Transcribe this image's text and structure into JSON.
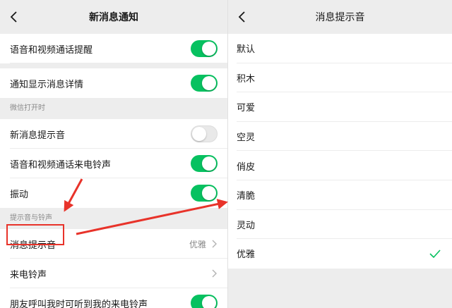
{
  "left": {
    "title": "新消息通知",
    "rows_top": [
      {
        "label": "语音和视频通话提醒",
        "state": "on"
      },
      {
        "label": "通知显示消息详情",
        "state": "on"
      }
    ],
    "section_wechat_open": "微信打开时",
    "rows_wechat_open": [
      {
        "label": "新消息提示音",
        "state": "off"
      },
      {
        "label": "语音和视频通话来电铃声",
        "state": "on"
      },
      {
        "label": "振动",
        "state": "on"
      }
    ],
    "section_sounds": "提示音与铃声",
    "message_tone": {
      "label": "消息提示音",
      "value": "优雅"
    },
    "ringtone": {
      "label": "来电铃声"
    },
    "friend_ring": {
      "label": "朋友呼叫我时可听到我的来电铃声",
      "state": "on"
    }
  },
  "right": {
    "title": "消息提示音",
    "options": [
      "默认",
      "积木",
      "可爱",
      "空灵",
      "俏皮",
      "清脆",
      "灵动",
      "优雅"
    ],
    "selected_index": 7
  },
  "colors": {
    "switch_on": "#07c160",
    "annotation": "#e8332a",
    "check": "#07c160"
  },
  "icons": {
    "back": "chevron-left-icon",
    "chevron": "chevron-right-icon",
    "selected": "checkmark-icon"
  }
}
